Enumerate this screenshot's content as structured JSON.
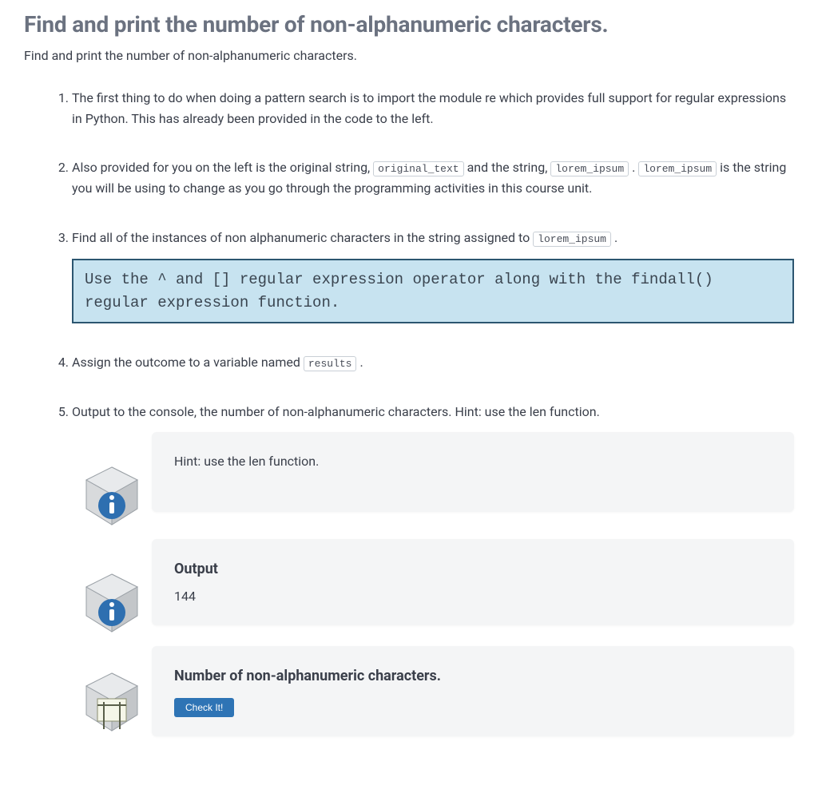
{
  "title": "Find and print the number of non-alphanumeric characters.",
  "subtitle": "Find and print the number of non-alphanumeric characters.",
  "steps": {
    "s1": "The first thing to do when doing a pattern search is to import the module re which provides full support for regular expressions in Python. This has already been provided in the code to the left.",
    "s2": {
      "pre1": "Also provided for you on the left is the original string, ",
      "code1": "original_text",
      "mid1": " and the string, ",
      "code2": "lorem_ipsum",
      "mid2": " . ",
      "code3": "lorem_ipsum",
      "post": " is the string you will be using to change as you go through the programming activities in this course unit."
    },
    "s3": {
      "pre": "Find all of the instances of non alphanumeric characters in the string assigned to ",
      "code": "lorem_ipsum",
      "post": " .",
      "hint": "Use the ^ and [] regular expression operator along with the findall() regular expression function."
    },
    "s4": {
      "pre": "Assign the outcome to a variable named ",
      "code": "results",
      "post": " ."
    },
    "s5": "Output to the console, the number of non-alphanumeric characters. Hint: use the len function."
  },
  "cards": {
    "hint": {
      "text": "Hint: use the len function."
    },
    "output": {
      "heading": "Output",
      "value": "144"
    },
    "checker": {
      "heading": "Number of non-alphanumeric characters.",
      "button": "Check It!"
    }
  }
}
